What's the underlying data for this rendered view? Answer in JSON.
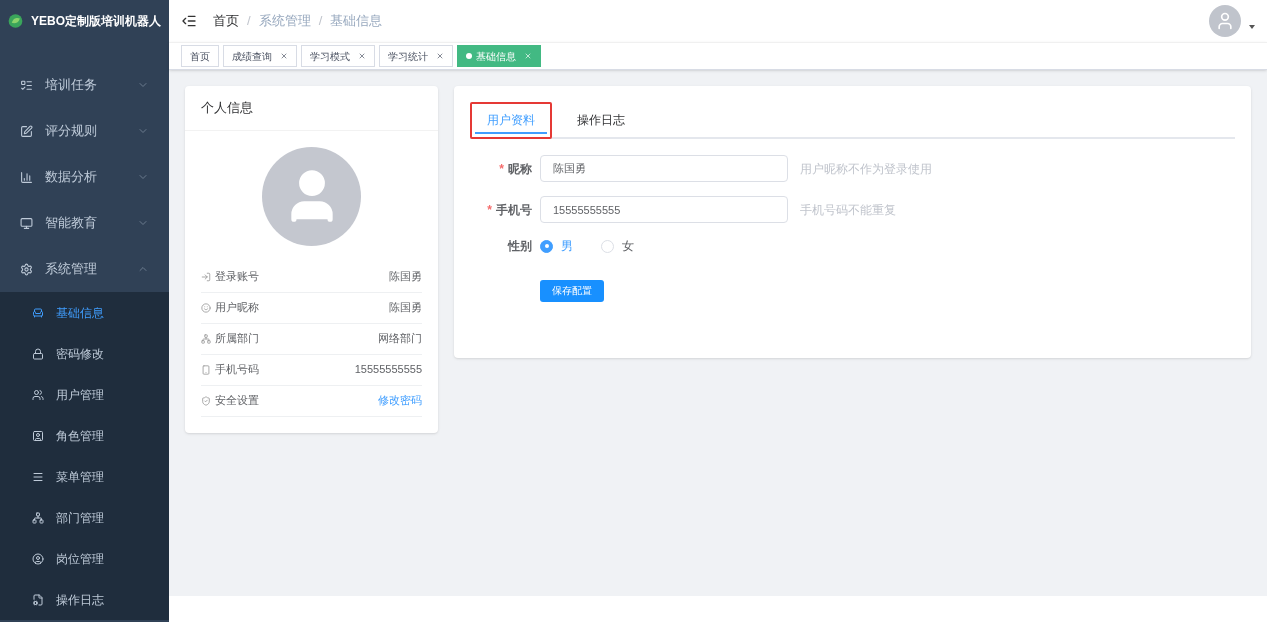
{
  "brand": {
    "title": "YEBO定制版培训机器人"
  },
  "sidebar": {
    "items": [
      {
        "label": "培训任务",
        "expanded": false
      },
      {
        "label": "评分规则",
        "expanded": false
      },
      {
        "label": "数据分析",
        "expanded": false
      },
      {
        "label": "智能教育",
        "expanded": false
      },
      {
        "label": "系统管理",
        "expanded": true,
        "children": [
          {
            "label": "基础信息",
            "selected": true
          },
          {
            "label": "密码修改",
            "selected": false
          },
          {
            "label": "用户管理",
            "selected": false
          },
          {
            "label": "角色管理",
            "selected": false
          },
          {
            "label": "菜单管理",
            "selected": false
          },
          {
            "label": "部门管理",
            "selected": false
          },
          {
            "label": "岗位管理",
            "selected": false
          },
          {
            "label": "操作日志",
            "selected": false
          }
        ]
      }
    ]
  },
  "breadcrumb": [
    {
      "label": "首页",
      "link": true
    },
    {
      "separator": "/",
      "label": "系统管理",
      "link": false
    },
    {
      "separator": "/",
      "label": "基础信息",
      "link": false
    }
  ],
  "tags": [
    {
      "label": "首页",
      "selected": false,
      "closable": false
    },
    {
      "label": "成绩查询",
      "selected": false,
      "closable": true
    },
    {
      "label": "学习模式",
      "selected": false,
      "closable": true
    },
    {
      "label": "学习统计",
      "selected": false,
      "closable": true
    },
    {
      "label": "基础信息",
      "selected": true,
      "closable": true
    }
  ],
  "profile_card": {
    "title": "个人信息",
    "fields": [
      {
        "label": "登录账号",
        "value": "陈国勇",
        "kind": "text"
      },
      {
        "label": "用户昵称",
        "value": "陈国勇",
        "kind": "text"
      },
      {
        "label": "所属部门",
        "value": "网络部门",
        "kind": "text"
      },
      {
        "label": "手机号码",
        "value": "15555555555",
        "kind": "text"
      },
      {
        "label": "安全设置",
        "value": "修改密码",
        "kind": "link"
      }
    ]
  },
  "tabs": [
    {
      "label": "用户资料",
      "selected": true,
      "highlighted": true
    },
    {
      "label": "操作日志",
      "selected": false,
      "highlighted": false
    }
  ],
  "form": {
    "fields": [
      {
        "label": "昵称",
        "required": true,
        "required_mark": "*",
        "value": "陈国勇",
        "hint": "用户昵称不作为登录使用"
      },
      {
        "label": "手机号",
        "required": true,
        "required_mark": "*",
        "value": "15555555555",
        "hint": "手机号码不能重复"
      }
    ],
    "gender": {
      "label": "性别",
      "options": [
        {
          "label": "男",
          "selected": true
        },
        {
          "label": "女",
          "selected": false
        }
      ]
    },
    "save_button": "保存配置"
  }
}
